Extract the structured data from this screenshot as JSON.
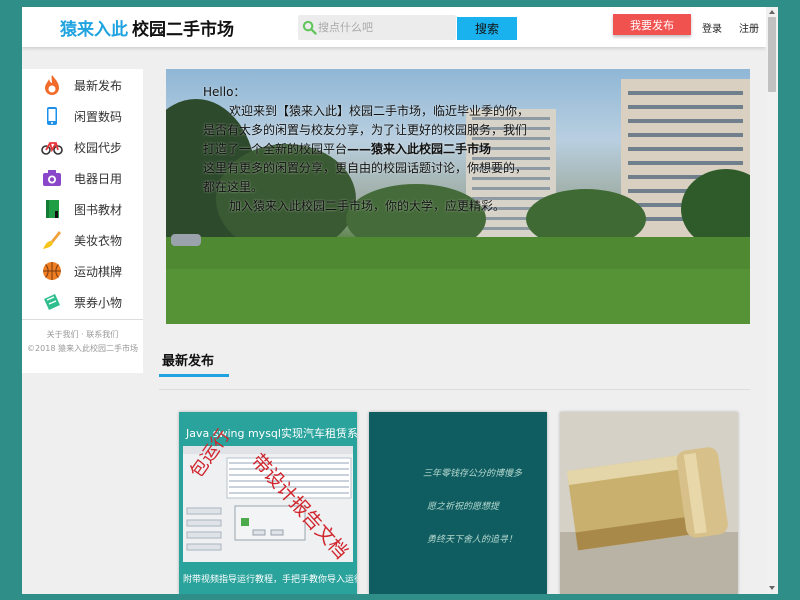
{
  "header": {
    "brand_name": "猿来入此",
    "brand_sub": "校园二手市场",
    "search_placeholder": "搜点什么吧",
    "search_button": "搜索",
    "publish_button": "我要发布",
    "login": "登录",
    "register": "注册"
  },
  "sidebar": {
    "items": [
      {
        "label": "最新发布",
        "icon": "fire-icon"
      },
      {
        "label": "闲置数码",
        "icon": "phone-icon"
      },
      {
        "label": "校园代步",
        "icon": "bicycle-icon"
      },
      {
        "label": "电器日用",
        "icon": "camera-icon"
      },
      {
        "label": "图书教材",
        "icon": "book-icon"
      },
      {
        "label": "美妆衣物",
        "icon": "brush-icon"
      },
      {
        "label": "运动棋牌",
        "icon": "basketball-icon"
      },
      {
        "label": "票券小物",
        "icon": "ticket-icon"
      }
    ],
    "footer_links": "关于我们 · 联系我们",
    "footer_copyright": "©2018 猿来入此校园二手市场"
  },
  "banner": {
    "greeting": "Hello：",
    "p1_pre": "欢迎来到【猿来入此】校园二手市场，临近毕业季的你，是否有太多的闲置与校友分享，为了让更好的校园服务，我们打造了一个全新的校园平台",
    "p1_bold": "——猿来入此校园二手市场",
    "p2": "这里有更多的闲置分享，更自由的校园话题讨论，你想要的，都在这里。",
    "p3": "加入猿来入此校园二手市场，你的大学，应更精彩。"
  },
  "section": {
    "title": "最新发布"
  },
  "cards": [
    {
      "title": "Java swing mysql实现汽车租赁系统",
      "caption": "附带视频指导运行教程，手把手教你导入运行",
      "stamp1": "包运行",
      "stamp2": "带设计报告文档"
    },
    {
      "lines": [
        "三年零钱存公分的博慢多",
        "愿之祈祝的愿想提",
        "勇终天下舍人的追寻！"
      ]
    },
    {
      "image": "sunscreen-bottle-photo"
    }
  ],
  "colors": {
    "brand": "#1fa3e0",
    "publish": "#f0524f",
    "search_button": "#1ab2ee",
    "page_bg": "#2f8f88"
  }
}
